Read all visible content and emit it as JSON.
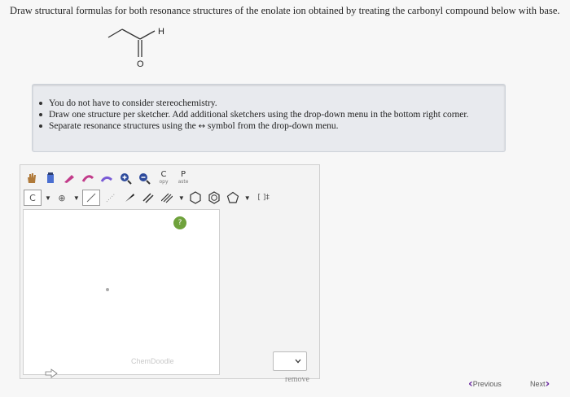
{
  "question": {
    "prompt": "Draw structural formulas for both resonance structures of the enolate ion obtained by treating the carbonyl compound below with base.",
    "molecule_labels": {
      "hydrogen": "H",
      "oxygen": "O"
    }
  },
  "notes": [
    "You do not have to consider stereochemistry.",
    "Draw one structure per sketcher. Add additional sketchers using the drop-down menu in the bottom right corner.",
    "Separate resonance structures using the ",
    " symbol from the drop-down menu."
  ],
  "resonance_arrow": "↔",
  "sketcher": {
    "toolbar": {
      "copy_label": "C",
      "copy_sub": "opy",
      "paste_label": "P",
      "paste_sub": "aste",
      "element_label": "C",
      "charge_label": "⊕",
      "bracket_label": "[ ]‡"
    },
    "watermark": "ChemDoodle",
    "help": "?"
  },
  "actions": {
    "remove_label": "remove"
  },
  "navigation": {
    "previous": "Previous",
    "next": "Next"
  }
}
